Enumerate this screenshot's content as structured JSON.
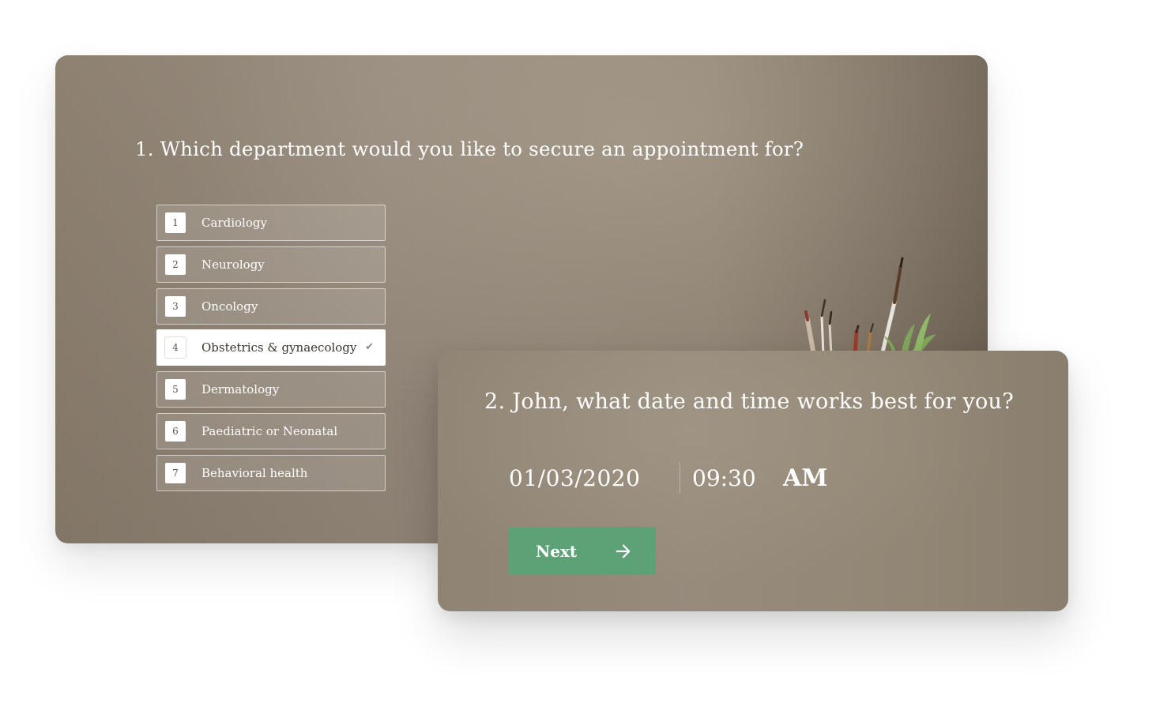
{
  "step1": {
    "question": "1. Which department would you like to secure an appointment for?",
    "options": [
      {
        "key": "1",
        "label": "Cardiology",
        "selected": false
      },
      {
        "key": "2",
        "label": "Neurology",
        "selected": false
      },
      {
        "key": "3",
        "label": "Oncology",
        "selected": false
      },
      {
        "key": "4",
        "label": "Obstetrics & gynaecology",
        "selected": true
      },
      {
        "key": "5",
        "label": "Dermatology",
        "selected": false
      },
      {
        "key": "6",
        "label": "Paediatric or Neonatal",
        "selected": false
      },
      {
        "key": "7",
        "label": "Behavioral health",
        "selected": false
      }
    ],
    "selected_check_icon": "check-icon"
  },
  "step2": {
    "question": "2. John, what date and time works best for you?",
    "date": "01/03/2020",
    "time": "09:30",
    "ampm": "AM",
    "next_label": "Next",
    "next_icon": "arrow-right-icon"
  },
  "colors": {
    "card_background": "#928675",
    "accent_green": "#5da276",
    "text": "#ffffff"
  }
}
